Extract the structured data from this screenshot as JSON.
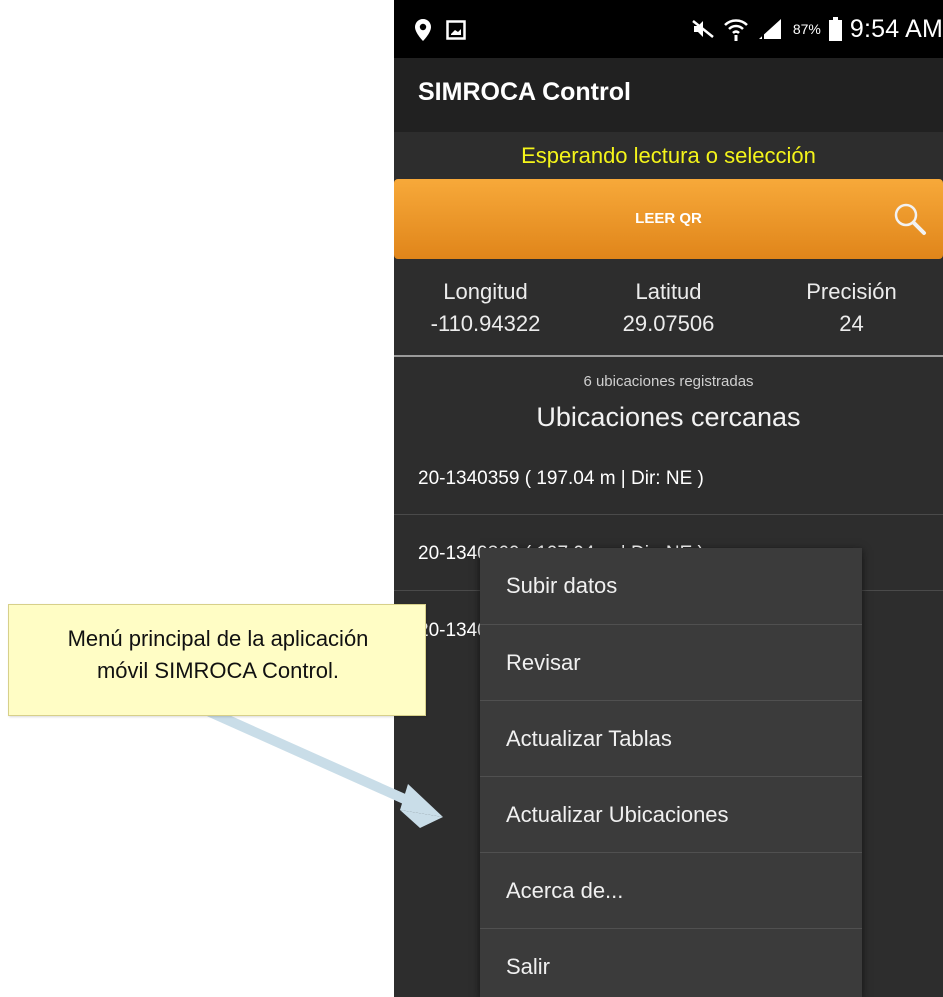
{
  "status_bar": {
    "battery_percent": "87%",
    "time": "9:54 AM"
  },
  "app": {
    "title": "SIMROCA Control"
  },
  "reading_status": "Esperando lectura o selección",
  "qr_button": {
    "label": "LEER QR"
  },
  "coordinates": {
    "longitude": {
      "label": "Longitud",
      "value": "-110.94322"
    },
    "latitude": {
      "label": "Latitud",
      "value": "29.07506"
    },
    "precision": {
      "label": "Precisión",
      "value": "24"
    }
  },
  "registered_count": "6 ubicaciones registradas",
  "nearby": {
    "title": "Ubicaciones cercanas",
    "items": [
      "20-1340359 ( 197.04 m | Dir: NE )",
      "20-1340360 ( 197.04 m | Dir: NE )",
      "20-1340361"
    ]
  },
  "menu": {
    "items": [
      "Subir datos",
      "Revisar",
      "Actualizar Tablas",
      "Actualizar Ubicaciones",
      "Acerca de...",
      "Salir"
    ]
  },
  "callout": {
    "line1": "Menú principal de la aplicación",
    "line2": "móvil SIMROCA Control."
  },
  "colors": {
    "status_text": "#f4f41a",
    "qr_button": "#e98f22",
    "background": "#2d2d2d",
    "menu_background": "#3b3b3b",
    "callout_background": "#fffdc5",
    "arrow": "#c9dde8"
  }
}
